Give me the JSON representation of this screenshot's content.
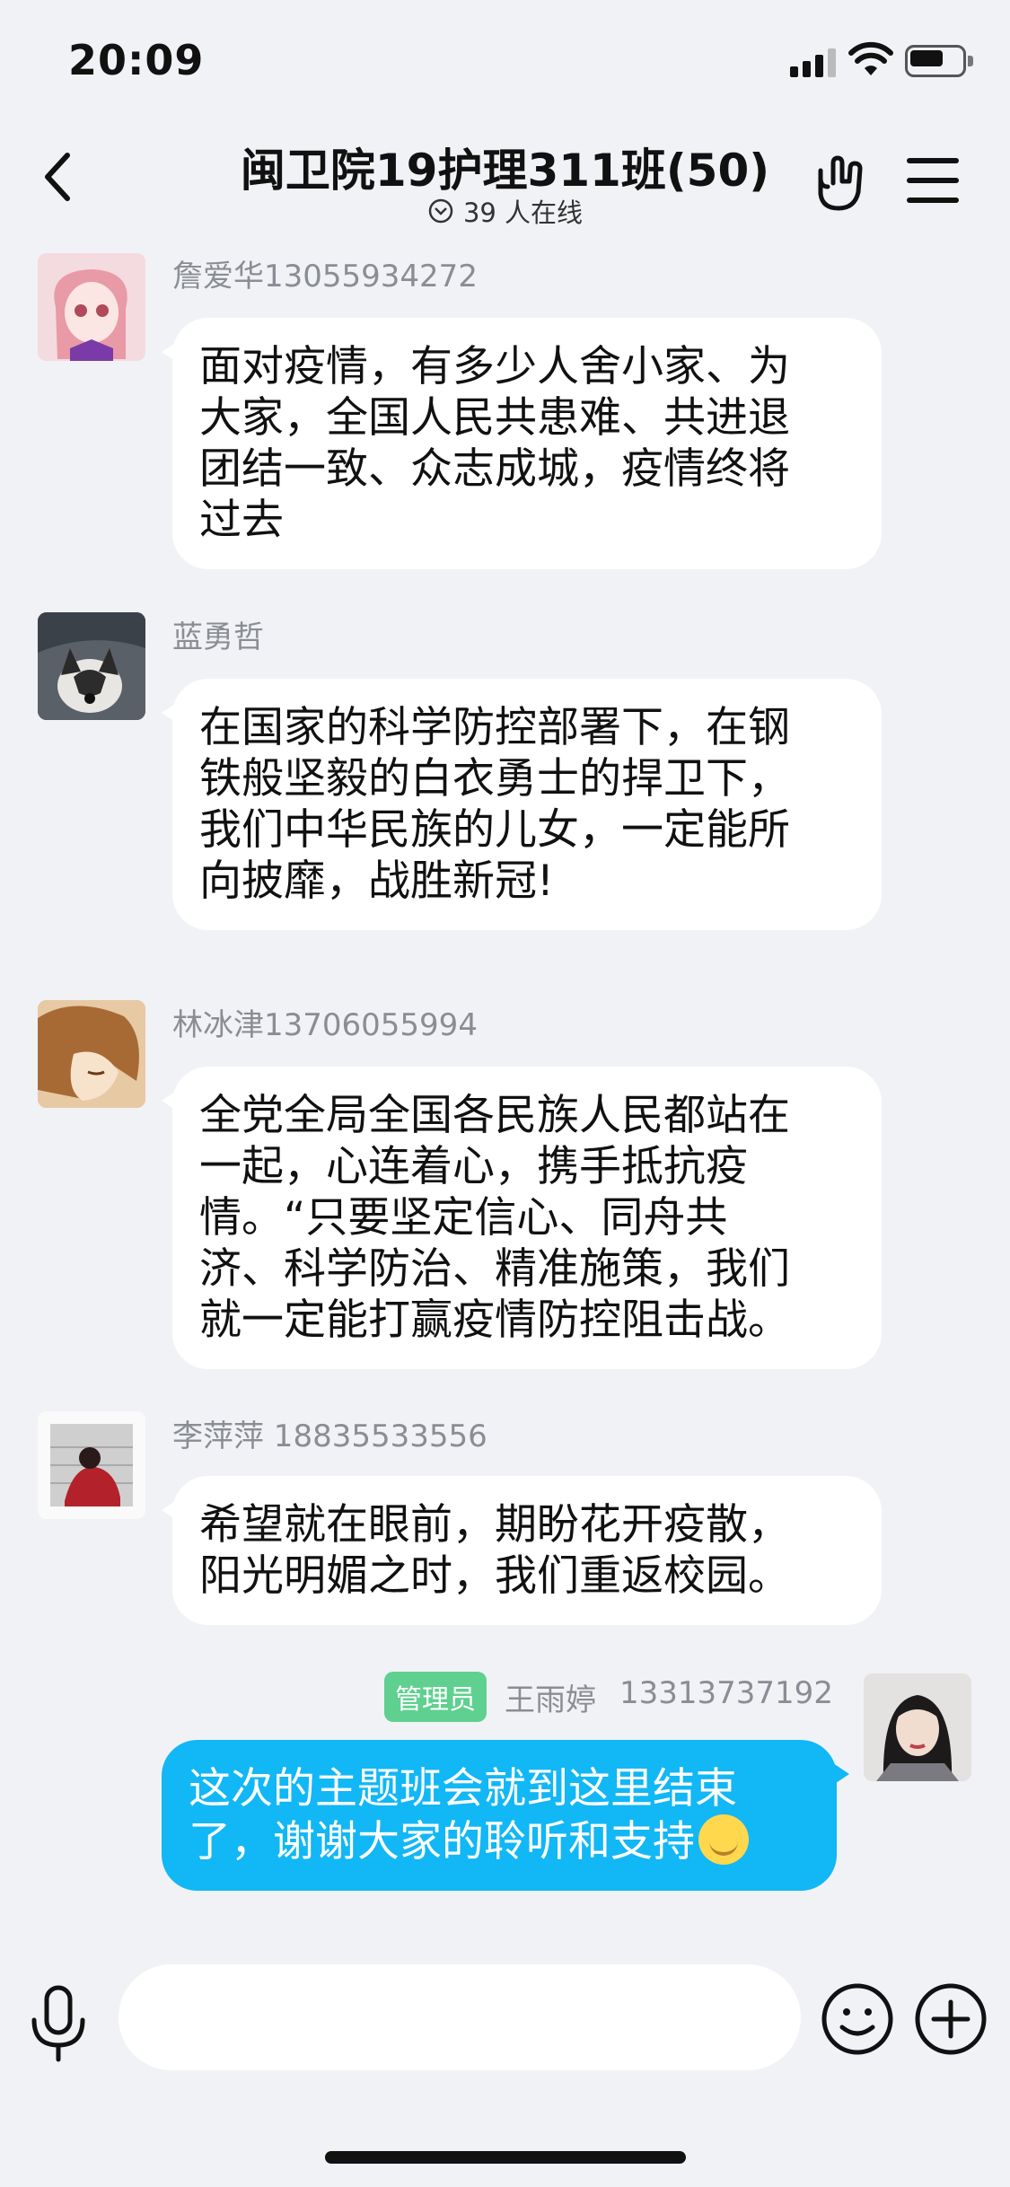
{
  "status_bar": {
    "time": "20:09",
    "battery_level": 0.65
  },
  "header": {
    "title": "闽卫院19护理311班(50)",
    "online_count_text": "39 人在线",
    "icons": [
      "back-chevron-icon",
      "hand-gesture-icon",
      "menu-icon",
      "chevron-down-icon"
    ]
  },
  "messages": [
    {
      "sender": "詹爱华13055934272",
      "avatar": "anime-pink-hair-girl",
      "text": [
        "面对疫情，有多少人舍小家、为",
        "大家，全国人民共患难、共进退",
        "团结一致、众志成城，疫情终将",
        "过去"
      ]
    },
    {
      "sender": "蓝勇哲",
      "avatar": "husky-dog",
      "text": [
        "在国家的科学防控部署下，在钢",
        "铁般坚毅的白衣勇士的捍卫下，",
        "我们中华民族的儿女，一定能所",
        "向披靡，战胜新冠!"
      ]
    },
    {
      "sender": "林冰津13706055994",
      "avatar": "anime-brown-hair-boy",
      "text": [
        "全党全局全国各民族人民都站在",
        "一起，心连着心，携手抵抗疫",
        "情。“只要坚定信心、同舟共",
        "济、科学防治、精准施策，我们",
        "就一定能打赢疫情防控阻击战。"
      ]
    },
    {
      "sender": "李萍萍 18835533556",
      "avatar": "person-photo",
      "text": [
        "希望就在眼前，期盼花开疫散，",
        "阳光明媚之时，我们重返校园。"
      ]
    },
    {
      "role_badge": "管理员",
      "sender": "王雨婷",
      "sender_phone": "13313737192",
      "avatar": "woman-portrait",
      "text": [
        "这次的主题班会就到这里结束",
        "了，谢谢大家的聆听和支持"
      ],
      "emoji": "smiling-face-emoji"
    }
  ],
  "input_bar": {
    "placeholder": "",
    "icons": [
      "microphone-icon",
      "emoji-icon",
      "plus-icon"
    ]
  },
  "colors": {
    "background": "#f1f2f6",
    "my_bubble": "#12b7f5",
    "admin_badge": "#5fd08f"
  }
}
